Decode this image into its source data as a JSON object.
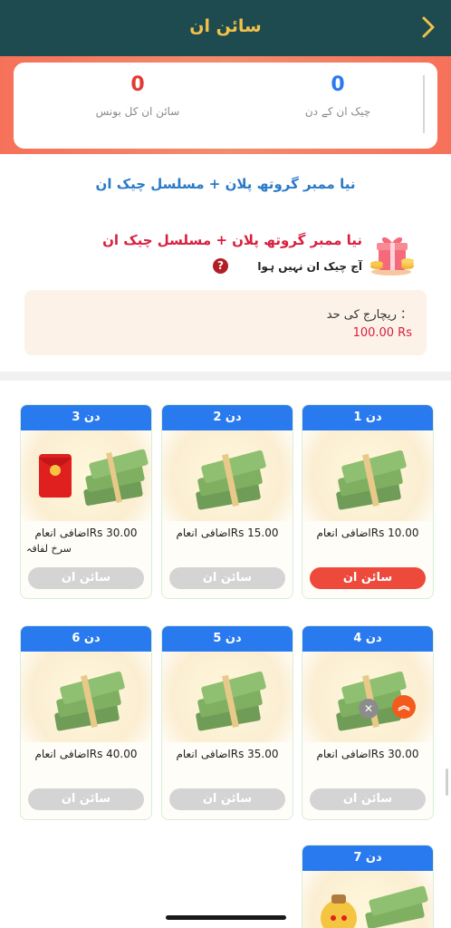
{
  "header": {
    "title": "سائن ان"
  },
  "stats": {
    "total_bonus": {
      "value": "0",
      "label": "سائن ان کل بونس",
      "color": "#e53935"
    },
    "checkin_days": {
      "value": "0",
      "label": "چیک ان کے دن",
      "color": "#2a7aef"
    }
  },
  "plan": {
    "title": "نیا ممبر گروتھ پلان + مسلسل چیک ان",
    "subtitle": "نیا ممبر گروتھ پلان + مسلسل چیک ان",
    "note": "آج چیک ان نہیں ہوا",
    "help_icon": "question-circle-icon",
    "gift_icon": "gift-box-icon"
  },
  "recharge": {
    "label": "ریچارج کی حد ：",
    "value": "100.00 Rs"
  },
  "days": [
    {
      "day": "دن 1",
      "reward": "اضافی انعامRs 10.00",
      "button": "سائن ان",
      "active": true
    },
    {
      "day": "دن 2",
      "reward": "اضافی انعامRs 15.00",
      "button": "سائن ان",
      "active": false
    },
    {
      "day": "دن 3",
      "reward": "اضافی انعامRs 30.00",
      "extra": "سرخ لفافہ",
      "button": "سائن ان",
      "active": false
    },
    {
      "day": "دن 4",
      "reward": "اضافی انعامRs 30.00",
      "button": "سائن ان",
      "active": false
    },
    {
      "day": "دن 5",
      "reward": "اضافی انعامRs 35.00",
      "button": "سائن ان",
      "active": false
    },
    {
      "day": "دن 6",
      "reward": "اضافی انعامRs 40.00",
      "button": "سائن ان",
      "active": false
    },
    {
      "day": "دن 7"
    }
  ],
  "colors": {
    "header_bg": "#1d4b4f",
    "title": "#f2c14a",
    "accent_red": "#d8203e",
    "day_header": "#2a7aef",
    "active_button": "#ee4a3c"
  }
}
